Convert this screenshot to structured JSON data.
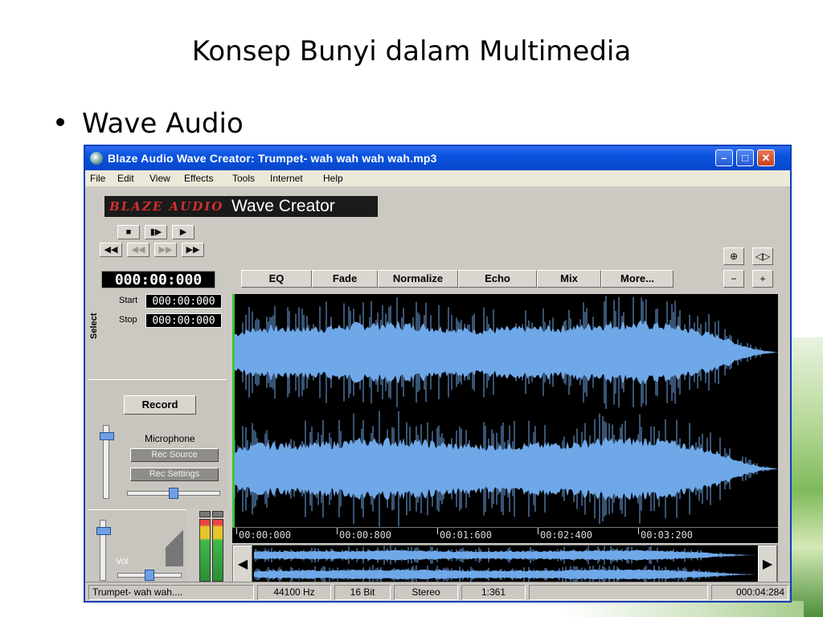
{
  "slide": {
    "title": "Konsep Bunyi dalam Multimedia",
    "bullet": "Wave Audio"
  },
  "window": {
    "title": "Blaze Audio Wave Creator: Trumpet- wah wah wah wah.mp3",
    "controls": {
      "minimize": "–",
      "maximize": "□",
      "close": "✕"
    }
  },
  "menu": [
    "File",
    "Edit",
    "View",
    "Effects",
    "Tools",
    "Internet",
    "Help"
  ],
  "brand": {
    "logo": "BLAZE AUDIO",
    "product": "Wave Creator"
  },
  "transport": {
    "row1": [
      "■",
      "▮▶",
      "▶"
    ],
    "row2": [
      "◀◀",
      "◀◀",
      "▶▶",
      "▶▶"
    ]
  },
  "time": {
    "current": "000:00:000"
  },
  "selection": {
    "label": "Select",
    "start_label": "Start",
    "start": "000:00:000",
    "stop_label": "Stop",
    "stop": "000:00:000"
  },
  "recording": {
    "record_label": "Record",
    "source_label": "Microphone",
    "rec_source": "Rec Source",
    "rec_settings": "Rec Settings",
    "input_level": 0.9,
    "balance": 0.5
  },
  "volume": {
    "label": "Vol",
    "level": 0.88,
    "balance": 0.5
  },
  "effects": [
    "EQ",
    "Fade",
    "Normalize",
    "Echo",
    "Mix",
    "More..."
  ],
  "zoom_icons": [
    "zoom-selection-icon",
    "fit-width-icon",
    "zoom-out-icon",
    "zoom-in-icon"
  ],
  "timeline": [
    "00:00:000",
    "00:00:800",
    "00:01:600",
    "00:02:400",
    "00:03:200"
  ],
  "status": {
    "file": "Trumpet- wah wah....",
    "rate": "44100 Hz",
    "bits": "16 Bit",
    "channels": "Stereo",
    "zoom": "1:361",
    "length": "000:04:284"
  },
  "colors": {
    "wave": "#6fa8e8",
    "wave_bg": "#000000",
    "cursor": "#38c838",
    "titlebar": "#0a53e0"
  }
}
